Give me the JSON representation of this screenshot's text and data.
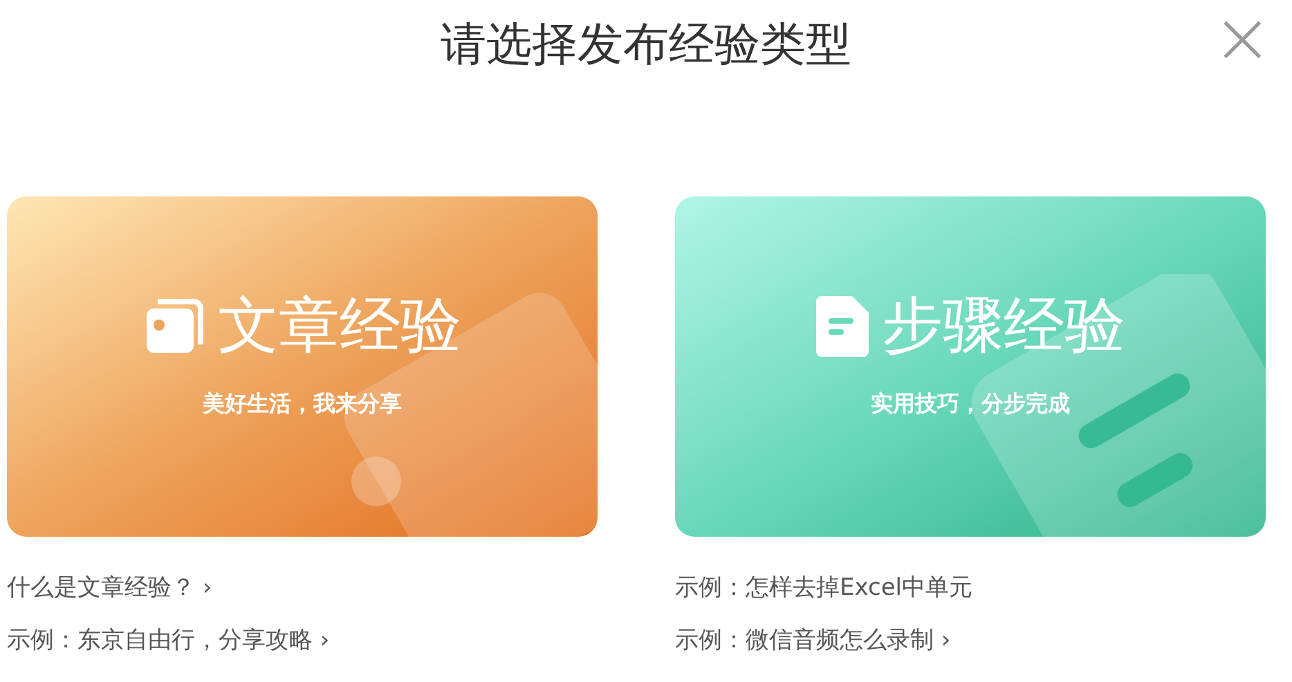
{
  "dialog": {
    "title": "请选择发布经验类型",
    "close": "×"
  },
  "options": [
    {
      "kind": "article",
      "title": "文章经验",
      "subtitle": "美好生活，我来分享",
      "links": [
        {
          "text": "什么是文章经验？",
          "arrow": "›"
        },
        {
          "text": "示例：东京自由行，分享攻略",
          "arrow": "›"
        }
      ]
    },
    {
      "kind": "steps",
      "title": "步骤经验",
      "subtitle": "实用技巧，分步完成",
      "links": [
        {
          "text": "示例：怎样去掉Excel中单元"
        },
        {
          "text": "示例：微信音频怎么录制",
          "arrow": "›"
        }
      ]
    }
  ]
}
